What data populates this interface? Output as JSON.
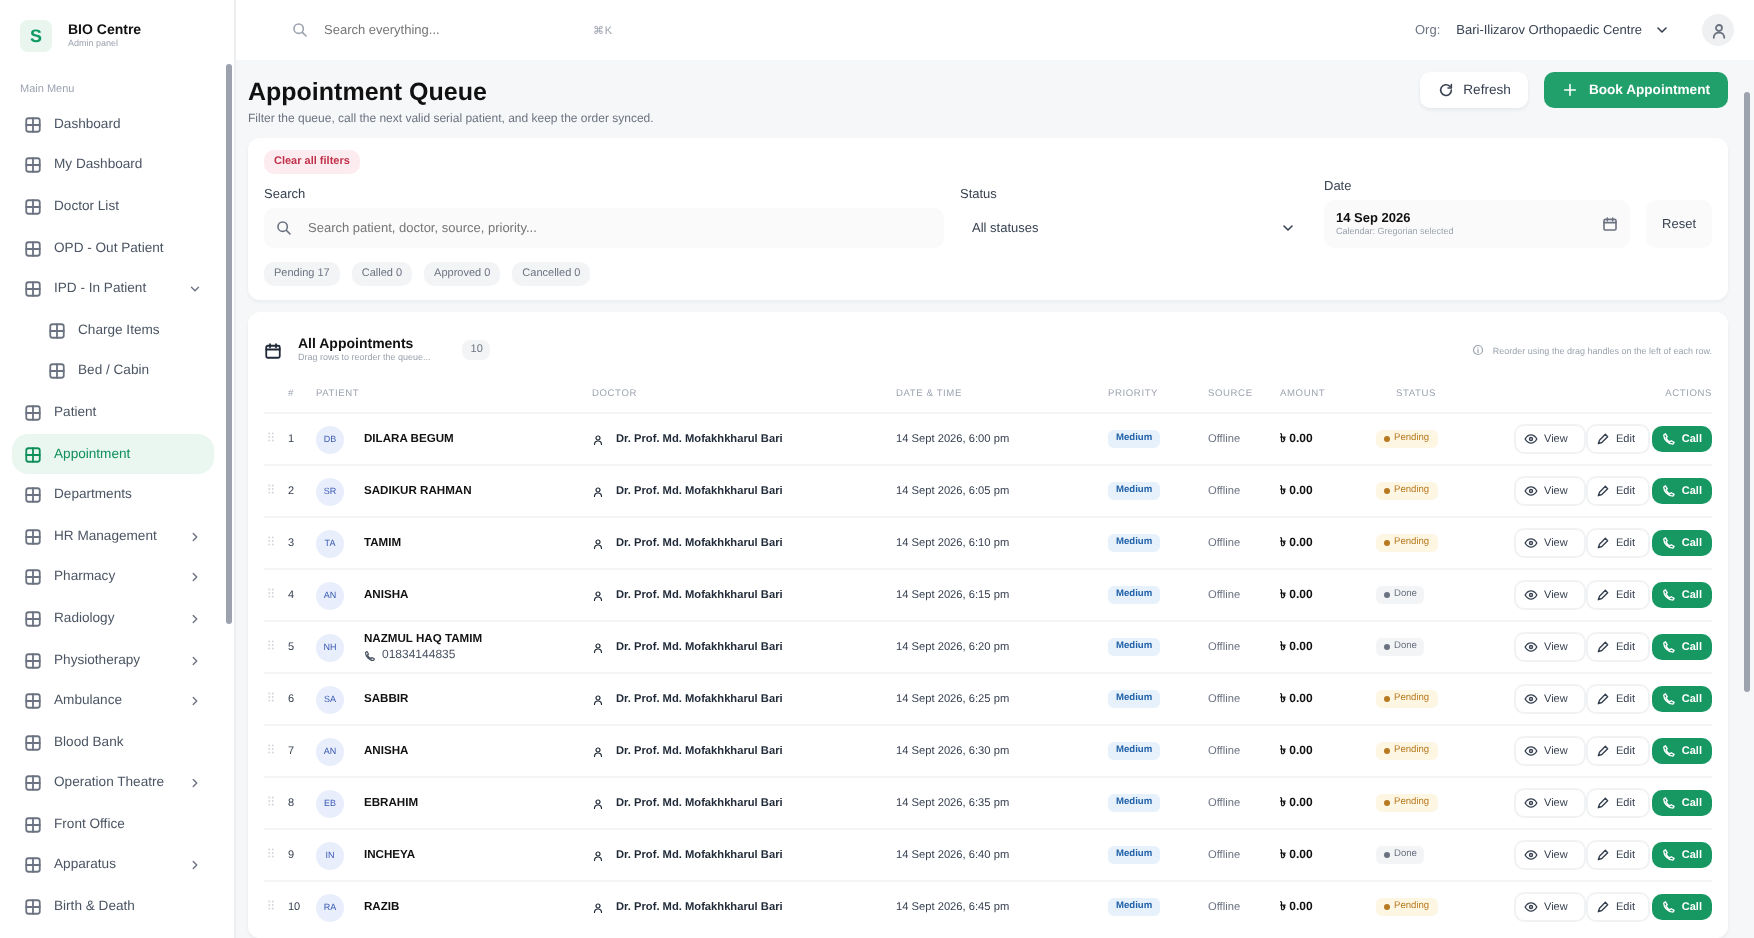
{
  "sidebar": {
    "brand": "BIO Centre",
    "brand_subtitle": "Admin panel",
    "logo": "S",
    "section": "Main Menu",
    "items": [
      {
        "label": "Dashboard",
        "selected": false
      },
      {
        "label": "My Dashboard",
        "selected": false
      },
      {
        "label": "Doctor List",
        "selected": false
      },
      {
        "label": "OPD - Out Patient",
        "selected": false
      },
      {
        "label": "IPD - In Patient",
        "selected": false,
        "expanded": true,
        "children": [
          {
            "label": "Charge Items",
            "selected": false
          },
          {
            "label": "Bed / Cabin",
            "selected": false
          }
        ]
      },
      {
        "label": "Patient",
        "selected": false
      },
      {
        "label": "Appointment",
        "selected": true
      },
      {
        "label": "Departments",
        "selected": false
      },
      {
        "label": "HR Management",
        "selected": false,
        "expanded": false
      },
      {
        "label": "Pharmacy",
        "selected": false,
        "expanded": false
      },
      {
        "label": "Radiology",
        "selected": false,
        "expanded": false
      },
      {
        "label": "Physiotherapy",
        "selected": false,
        "expanded": false
      },
      {
        "label": "Ambulance",
        "selected": false,
        "expanded": false
      },
      {
        "label": "Blood Bank",
        "selected": false
      },
      {
        "label": "Operation Theatre",
        "selected": false,
        "expanded": false
      },
      {
        "label": "Front Office",
        "selected": false
      },
      {
        "label": "Apparatus",
        "selected": false,
        "expanded": false
      },
      {
        "label": "Birth & Death",
        "selected": false
      }
    ]
  },
  "topbar": {
    "search": {
      "placeholder": "Search everything..."
    },
    "shortcut": "⌘K",
    "org_label": "Org:",
    "org": "Bari-Ilizarov Orthopaedic Centre"
  },
  "page": {
    "title": "Appointment Queue",
    "subtitle": "Filter the queue, call the next valid serial patient, and keep the order synced.",
    "buttons": [
      {
        "label": "Refresh",
        "kind": "secondary"
      },
      {
        "label": "Book Appointment",
        "kind": "primary"
      }
    ]
  },
  "filters": {
    "clear": "Clear all filters",
    "search_label": "Search",
    "search": {
      "placeholder": "Search patient, doctor, source, priority..."
    },
    "status_label": "Status",
    "status": {
      "value": "All statuses"
    },
    "date_label": "Date",
    "date": {
      "value": "14 Sep 2026",
      "hint": "Calendar: Gregorian selected"
    },
    "reset": "Reset",
    "counts": [
      "Pending 17",
      "Called 0",
      "Approved 0",
      "Cancelled 0"
    ]
  },
  "table": {
    "title": "All Appointments",
    "subtitle": "Drag rows to reorder the queue...",
    "count": "10",
    "hint": "Reorder using the drag handles on the left of each row.",
    "columns": [
      "#",
      "PATIENT",
      "DOCTOR",
      "DATE & TIME",
      "PRIORITY",
      "SOURCE",
      "AMOUNT",
      "STATUS",
      "ACTIONS"
    ],
    "rows": [
      {
        "num": "1",
        "initials": "DB",
        "name": "DILARA BEGUM",
        "doctor": "Dr. Prof. Md. Mofakhkharul Bari",
        "datetime": "14 Sept 2026, 6:00 pm",
        "priority": "Medium",
        "source": "Offline",
        "amount": "৳ 0.00",
        "status": {
          "label": "Pending",
          "kind": "pending"
        },
        "actions": [
          "View",
          "Edit",
          "Call"
        ]
      },
      {
        "num": "2",
        "initials": "SR",
        "name": "SADIKUR RAHMAN",
        "doctor": "Dr. Prof. Md. Mofakhkharul Bari",
        "datetime": "14 Sept 2026, 6:05 pm",
        "priority": "Medium",
        "source": "Offline",
        "amount": "৳ 0.00",
        "status": {
          "label": "Pending",
          "kind": "pending"
        },
        "actions": [
          "View",
          "Edit",
          "Call"
        ]
      },
      {
        "num": "3",
        "initials": "TA",
        "name": "TAMIM",
        "doctor": "Dr. Prof. Md. Mofakhkharul Bari",
        "datetime": "14 Sept 2026, 6:10 pm",
        "priority": "Medium",
        "source": "Offline",
        "amount": "৳ 0.00",
        "status": {
          "label": "Pending",
          "kind": "pending"
        },
        "actions": [
          "View",
          "Edit",
          "Call"
        ]
      },
      {
        "num": "4",
        "initials": "AN",
        "name": "ANISHA",
        "doctor": "Dr. Prof. Md. Mofakhkharul Bari",
        "datetime": "14 Sept 2026, 6:15 pm",
        "priority": "Medium",
        "source": "Offline",
        "amount": "৳ 0.00",
        "status": {
          "label": "Done",
          "kind": "done"
        },
        "actions": [
          "View",
          "Edit",
          "Call"
        ]
      },
      {
        "num": "5",
        "initials": "NH",
        "name": "NAZMUL HAQ TAMIM",
        "phone": "01834144835",
        "doctor": "Dr. Prof. Md. Mofakhkharul Bari",
        "datetime": "14 Sept 2026, 6:20 pm",
        "priority": "Medium",
        "source": "Offline",
        "amount": "৳ 0.00",
        "status": {
          "label": "Done",
          "kind": "done"
        },
        "actions": [
          "View",
          "Edit",
          "Call"
        ]
      },
      {
        "num": "6",
        "initials": "SA",
        "name": "SABBIR",
        "doctor": "Dr. Prof. Md. Mofakhkharul Bari",
        "datetime": "14 Sept 2026, 6:25 pm",
        "priority": "Medium",
        "source": "Offline",
        "amount": "৳ 0.00",
        "status": {
          "label": "Pending",
          "kind": "pending"
        },
        "actions": [
          "View",
          "Edit",
          "Call"
        ]
      },
      {
        "num": "7",
        "initials": "AN",
        "name": "ANISHA",
        "doctor": "Dr. Prof. Md. Mofakhkharul Bari",
        "datetime": "14 Sept 2026, 6:30 pm",
        "priority": "Medium",
        "source": "Offline",
        "amount": "৳ 0.00",
        "status": {
          "label": "Pending",
          "kind": "pending"
        },
        "actions": [
          "View",
          "Edit",
          "Call"
        ]
      },
      {
        "num": "8",
        "initials": "EB",
        "name": "EBRAHIM",
        "doctor": "Dr. Prof. Md. Mofakhkharul Bari",
        "datetime": "14 Sept 2026, 6:35 pm",
        "priority": "Medium",
        "source": "Offline",
        "amount": "৳ 0.00",
        "status": {
          "label": "Pending",
          "kind": "pending"
        },
        "actions": [
          "View",
          "Edit",
          "Call"
        ]
      },
      {
        "num": "9",
        "initials": "IN",
        "name": "INCHEYA",
        "doctor": "Dr. Prof. Md. Mofakhkharul Bari",
        "datetime": "14 Sept 2026, 6:40 pm",
        "priority": "Medium",
        "source": "Offline",
        "amount": "৳ 0.00",
        "status": {
          "label": "Done",
          "kind": "done"
        },
        "actions": [
          "View",
          "Edit",
          "Call"
        ]
      },
      {
        "num": "10",
        "initials": "RA",
        "name": "RAZIB",
        "doctor": "Dr. Prof. Md. Mofakhkharul Bari",
        "datetime": "14 Sept 2026, 6:45 pm",
        "priority": "Medium",
        "source": "Offline",
        "amount": "৳ 0.00",
        "status": {
          "label": "Pending",
          "kind": "pending"
        },
        "actions": [
          "View",
          "Edit",
          "Call"
        ]
      }
    ]
  }
}
